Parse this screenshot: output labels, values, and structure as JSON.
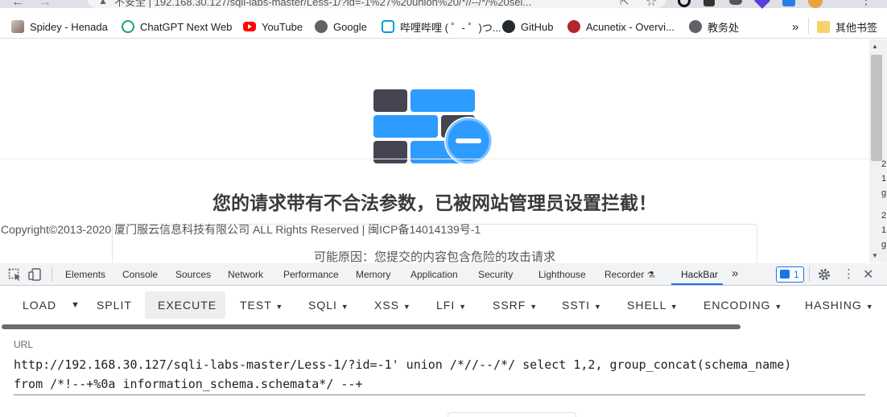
{
  "browser": {
    "address_text": "不安全 | 192.168.30.127/sqli-labs-master/Less-1/?id=-1%27%20union%20/*//--/*/%20sel..."
  },
  "bookmarks": [
    {
      "label": "Spidey - Henada",
      "icon": "avatar-icon",
      "color": "#9aa0a6"
    },
    {
      "label": "ChatGPT Next Web",
      "icon": "chatgpt-icon",
      "color": "#10a37f"
    },
    {
      "label": "YouTube",
      "icon": "youtube-icon",
      "color": "#ff0000"
    },
    {
      "label": "Google",
      "icon": "globe-icon",
      "color": "#5f6368"
    },
    {
      "label": "哔哩哔哩 ( ゜- ゜)つ...",
      "icon": "bilibili-icon",
      "color": "#00a1d6"
    },
    {
      "label": "GitHub",
      "icon": "github-icon",
      "color": "#24292e"
    },
    {
      "label": "Acunetix - Overvi...",
      "icon": "acunetix-icon",
      "color": "#b3262b"
    },
    {
      "label": "教务处",
      "icon": "globe-icon",
      "color": "#5f6368"
    }
  ],
  "bookmarks_more": "»",
  "other_bookmarks": "其他书签",
  "page": {
    "block_message": "您的请求带有不合法参数，已被网站管理员设置拦截！",
    "copyright": "Copyright©2013-2020 厦门服云信息科技有限公司 ALL Rights Reserved | 闽ICP备14014139号-1",
    "reason": "可能原因：您提交的内容包含危险的攻击请求",
    "right_cut_chars": [
      "2",
      "1",
      "g",
      "2",
      "1",
      "g"
    ]
  },
  "devtools": {
    "tabs": [
      "Elements",
      "Console",
      "Sources",
      "Network",
      "Performance",
      "Memory",
      "Application",
      "Security",
      "Lighthouse",
      "Recorder",
      "HackBar"
    ],
    "active_tab": "HackBar",
    "more": "»",
    "issues_count": "1"
  },
  "hackbar": {
    "buttons": [
      "LOAD",
      "SPLIT",
      "EXECUTE",
      "TEST",
      "SQLI",
      "XSS",
      "LFI",
      "SSRF",
      "SSTI",
      "SHELL",
      "ENCODING",
      "HASHING"
    ],
    "url_label": "URL",
    "url_value": "http://192.168.30.127/sqli-labs-master/Less-1/?id=-1' union /*//--/*/ select 1,2, group_concat(schema_name)\nfrom /*!--+%0a information_schema.schemata*/ --+"
  },
  "colors": {
    "brick_blue": "#2e9bff",
    "brick_dark": "#454552",
    "badge_blue": "#2e9bff",
    "accent": "#1a73e8"
  }
}
